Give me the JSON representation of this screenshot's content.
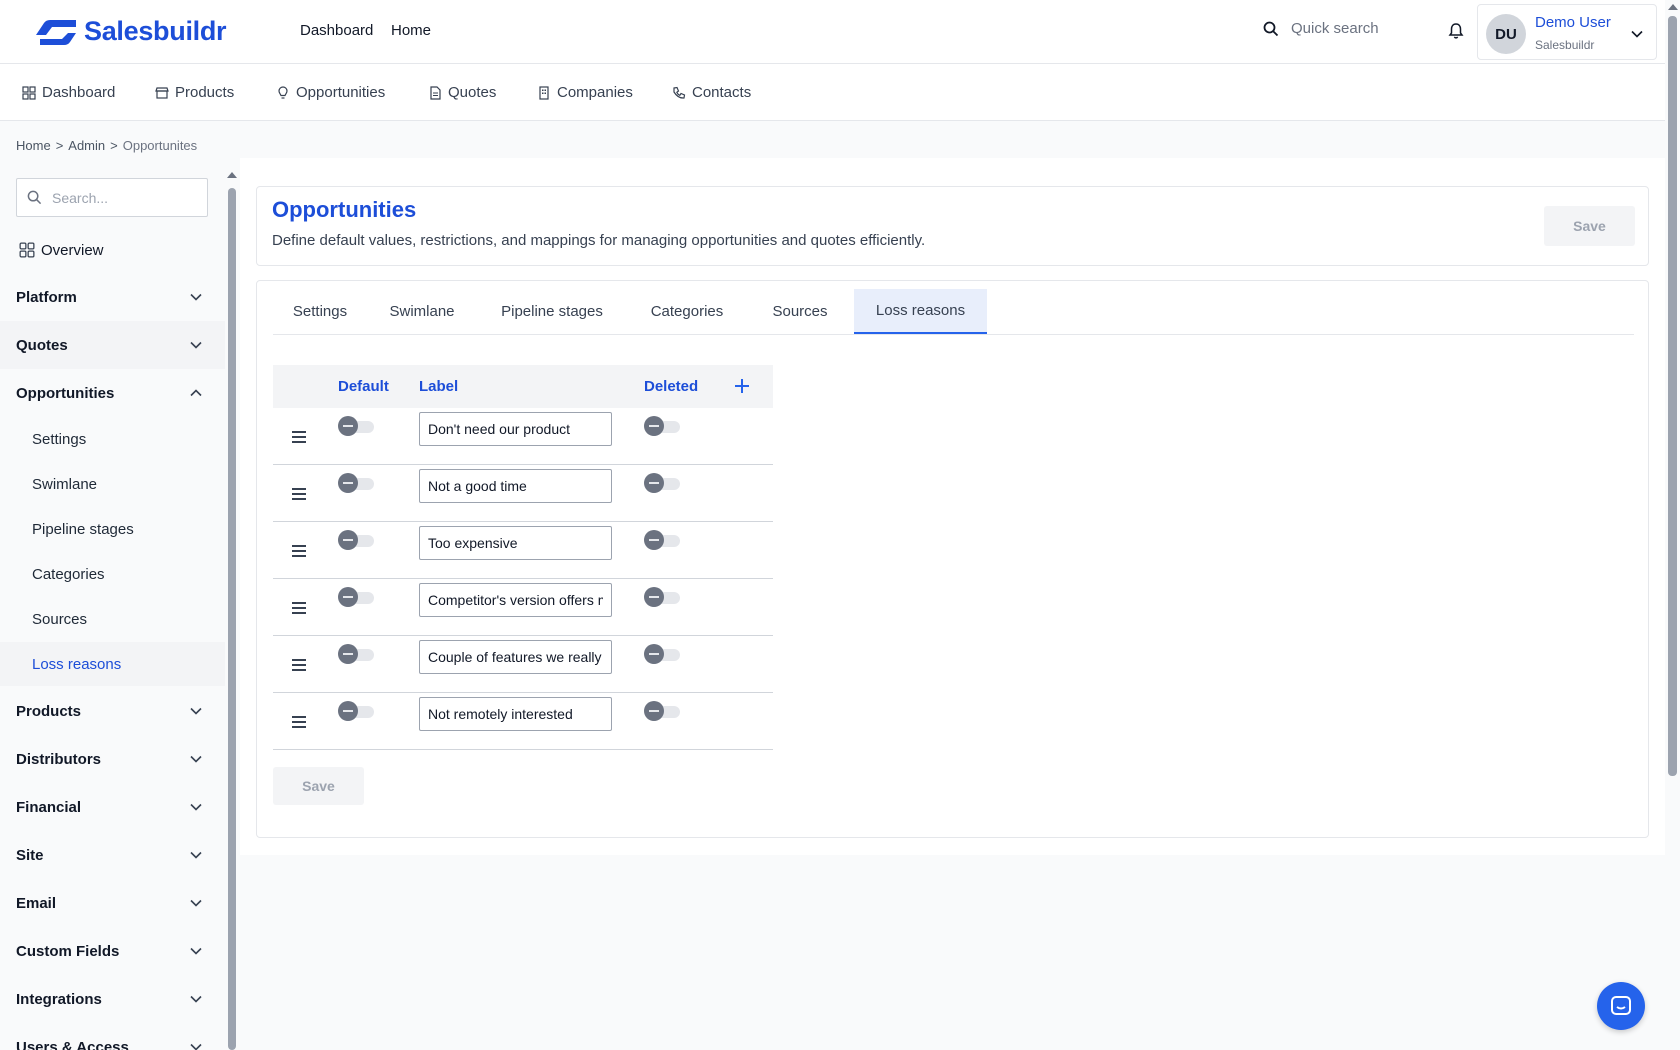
{
  "brand": {
    "name": "Salesbuildr",
    "color": "#1d4ed8"
  },
  "topnav": {
    "links": [
      "Dashboard",
      "Home"
    ]
  },
  "search": {
    "placeholder": "Quick search"
  },
  "user": {
    "initials": "DU",
    "name": "Demo User",
    "org": "Salesbuildr"
  },
  "modules": [
    {
      "label": "Dashboard",
      "icon": "grid-icon"
    },
    {
      "label": "Products",
      "icon": "store-icon"
    },
    {
      "label": "Opportunities",
      "icon": "lightbulb-icon"
    },
    {
      "label": "Quotes",
      "icon": "document-icon"
    },
    {
      "label": "Companies",
      "icon": "building-icon"
    },
    {
      "label": "Contacts",
      "icon": "phone-icon"
    }
  ],
  "breadcrumb": [
    "Home",
    ">",
    "Admin",
    ">",
    "Opportunites"
  ],
  "sidebar": {
    "search_placeholder": "Search...",
    "overview": "Overview",
    "groups": [
      "Platform",
      "Quotes",
      "Opportunities",
      "Products",
      "Distributors",
      "Financial",
      "Site",
      "Email",
      "Custom Fields",
      "Integrations",
      "Users & Access"
    ],
    "sub_items": [
      "Settings",
      "Swimlane",
      "Pipeline stages",
      "Categories",
      "Sources",
      "Loss reasons"
    ]
  },
  "page": {
    "title": "Opportunities",
    "description": "Define default values, restrictions, and mappings for managing opportunities and quotes efficiently.",
    "save_label": "Save"
  },
  "tabs": [
    "Settings",
    "Swimlane",
    "Pipeline stages",
    "Categories",
    "Sources",
    "Loss reasons"
  ],
  "active_tab": "Loss reasons",
  "table": {
    "headers": {
      "default": "Default",
      "label": "Label",
      "deleted": "Deleted"
    },
    "rows": [
      {
        "label": "Don't need our product",
        "default": false,
        "deleted": false
      },
      {
        "label": "Not a good time",
        "default": false,
        "deleted": false
      },
      {
        "label": "Too expensive",
        "default": false,
        "deleted": false
      },
      {
        "label": "Competitor's version offers more",
        "default": false,
        "deleted": false
      },
      {
        "label": "Couple of features we really need",
        "default": false,
        "deleted": false
      },
      {
        "label": "Not remotely interested",
        "default": false,
        "deleted": false
      }
    ],
    "save_label": "Save"
  },
  "colors": {
    "accent": "#1d4ed8",
    "active_tab_bg": "#e8eefb",
    "chat": "#2563eb"
  }
}
